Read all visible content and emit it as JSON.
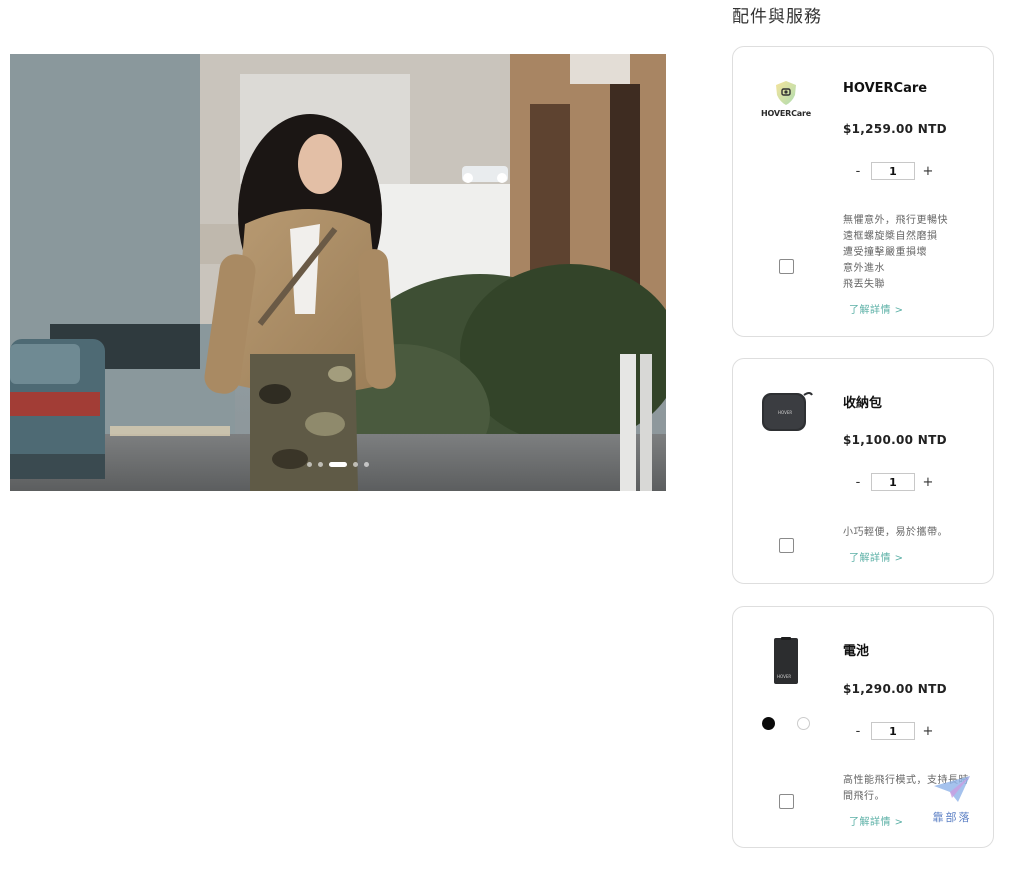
{
  "hero": {
    "slide_count": 5,
    "active_slide": 3
  },
  "section_title": "配件與服務",
  "products": [
    {
      "title": "HOVERCare",
      "logo_text": "HOVERCare",
      "price": "$1,259.00 NTD",
      "qty": "1",
      "qty_minus": "-",
      "qty_plus": "+",
      "desc": [
        "無懼意外，飛行更暢快",
        "遠框螺旋槳自然磨損",
        "遭受撞擊嚴重損壞",
        "意外進水",
        "飛丟失聯"
      ],
      "more": "了解詳情 >"
    },
    {
      "title": "收納包",
      "bag_logo": "HOVER",
      "price": "$1,100.00 NTD",
      "qty": "1",
      "qty_minus": "-",
      "qty_plus": "+",
      "desc": [
        "小巧輕便，易於攜帶。"
      ],
      "more": "了解詳情 >"
    },
    {
      "title": "電池",
      "battery_logo": "HOVER",
      "price": "$1,290.00 NTD",
      "qty": "1",
      "qty_minus": "-",
      "qty_plus": "+",
      "colors": [
        "#0a0a0a",
        "#ffffff"
      ],
      "desc": [
        "高性能飛行模式，支持長時",
        "間飛行。"
      ],
      "more": "了解詳情 >"
    }
  ],
  "watermark": "靠部落",
  "accent_color": "#5bb0a6"
}
